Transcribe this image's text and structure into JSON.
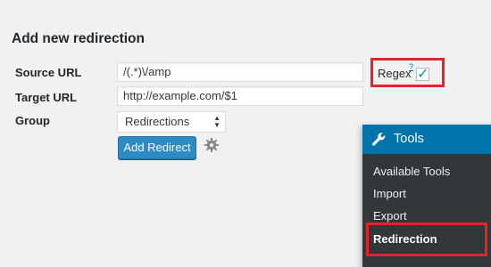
{
  "form": {
    "heading": "Add new redirection",
    "source_label": "Source URL",
    "source_value": "/(.*)\\/amp",
    "target_label": "Target URL",
    "target_value": "http://example.com/$1",
    "group_label": "Group",
    "group_selected": "Redirections",
    "add_button": "Add Redirect",
    "regex_label": "Regex",
    "regex_help": "?",
    "regex_checked": true
  },
  "menu": {
    "title": "Tools",
    "items": [
      "Available Tools",
      "Import",
      "Export",
      "Redirection"
    ],
    "current_index": 3
  },
  "colors": {
    "accent": "#0073aa",
    "button": "#2e8ac3",
    "menu_bg": "#32373c",
    "highlight": "#e62129"
  },
  "icons": {
    "settings": "gear-icon",
    "menu": "wrench-icon",
    "select_arrows": "sort-arrows-icon",
    "checkbox": "checkmark-icon"
  }
}
